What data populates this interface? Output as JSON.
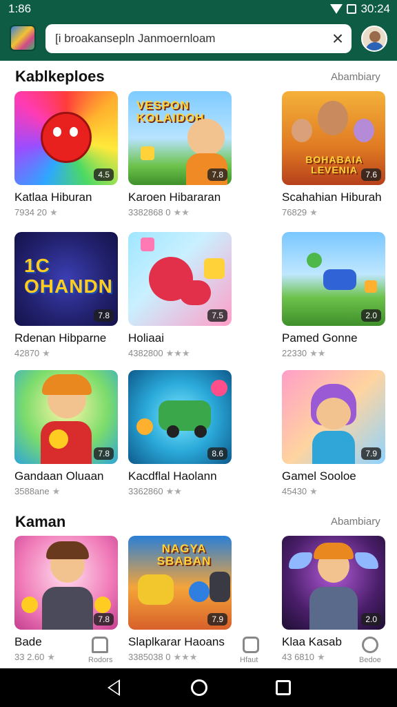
{
  "status": {
    "time": "1:86",
    "clock_right": "30:24"
  },
  "search": {
    "query": "[i broakansepln Janmoernloam"
  },
  "sections": [
    {
      "title": "Kablkeploes",
      "link": "Abambiary"
    },
    {
      "title": "Kaman",
      "link": "Abambiary"
    }
  ],
  "grid": [
    {
      "title": "Katlaa Hiburan",
      "meta": "7934 20",
      "badge": "4.5"
    },
    {
      "title": "Karoen Hibararan",
      "meta": "3382868 0",
      "badge": "7.8"
    },
    {
      "title": "Scahahian Hiburah",
      "meta": "76829",
      "badge": "7.6"
    },
    {
      "title": "Rdenan Hibparne",
      "meta": "42870",
      "badge": "7.8"
    },
    {
      "title": "Holiaai",
      "meta": "4382800",
      "badge": "7.5"
    },
    {
      "title": "Pamed Gonne",
      "meta": "22330",
      "badge": "2.0"
    },
    {
      "title": "Gandaan Oluaan",
      "meta": "3588ane",
      "badge": "7.8"
    },
    {
      "title": "Kacdflal Haolann",
      "meta": "3362860",
      "badge": "8.6"
    },
    {
      "title": "Gamel Sooloe",
      "meta": "45430",
      "badge": "7.9"
    }
  ],
  "row2": [
    {
      "title": "Bade",
      "meta": "33 2.60",
      "badge": "7.8"
    },
    {
      "title": "Slaplkarar Haoans",
      "meta": "3385038 0",
      "badge": "7.9"
    },
    {
      "title": "Klaa Kasab",
      "meta": "43 6810",
      "badge": "2.0"
    }
  ],
  "art_text": {
    "card2": "VESPON KOLAIDOH",
    "card3": "BOHABAIA LEVENIA",
    "card4": "1C OHANDN",
    "row2_card2": "NAGYA SBABAN"
  },
  "tabs": [
    {
      "label": "Rodors"
    },
    {
      "label": "Hfaut"
    },
    {
      "label": "Bedoe"
    }
  ],
  "colors": {
    "appbar": "#0f5c45"
  }
}
